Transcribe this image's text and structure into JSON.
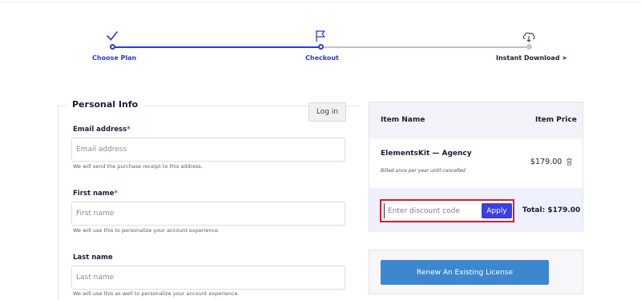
{
  "stepper": {
    "steps": [
      {
        "label": "Choose Plan",
        "icon": "check-icon"
      },
      {
        "label": "Checkout",
        "icon": "flag-icon"
      },
      {
        "label": "Instant Download",
        "icon": "cloud-download-icon",
        "suffix_icon": "rocket-icon"
      }
    ]
  },
  "personal_info": {
    "title": "Personal Info",
    "login_label": "Log in",
    "fields": [
      {
        "label": "Email address",
        "required": "*",
        "placeholder": "Email address",
        "value": "",
        "help": "We will send the purchase receipt to this address."
      },
      {
        "label": "First name",
        "required": "*",
        "placeholder": "First name",
        "value": "",
        "help": "We will use this to personalize your account experience."
      },
      {
        "label": "Last name",
        "required": "",
        "placeholder": "Last name",
        "value": "",
        "help": "We will use this as well to personalize your account experience."
      }
    ]
  },
  "order": {
    "col_name": "Item Name",
    "col_price": "Item Price",
    "item": {
      "name": "ElementsKit — Agency",
      "note": "Billed once per year until cancelled",
      "price": "$179.00"
    },
    "discount": {
      "placeholder": "Enter discount code",
      "value": "",
      "apply_label": "Apply"
    },
    "total": "Total: $179.00"
  },
  "renew": {
    "label": "Renew An Existing License"
  },
  "colors": {
    "accent": "#2b3bd6",
    "apply": "#3a3fe0",
    "renew": "#3d87cf",
    "highlight": "#e0182d"
  }
}
